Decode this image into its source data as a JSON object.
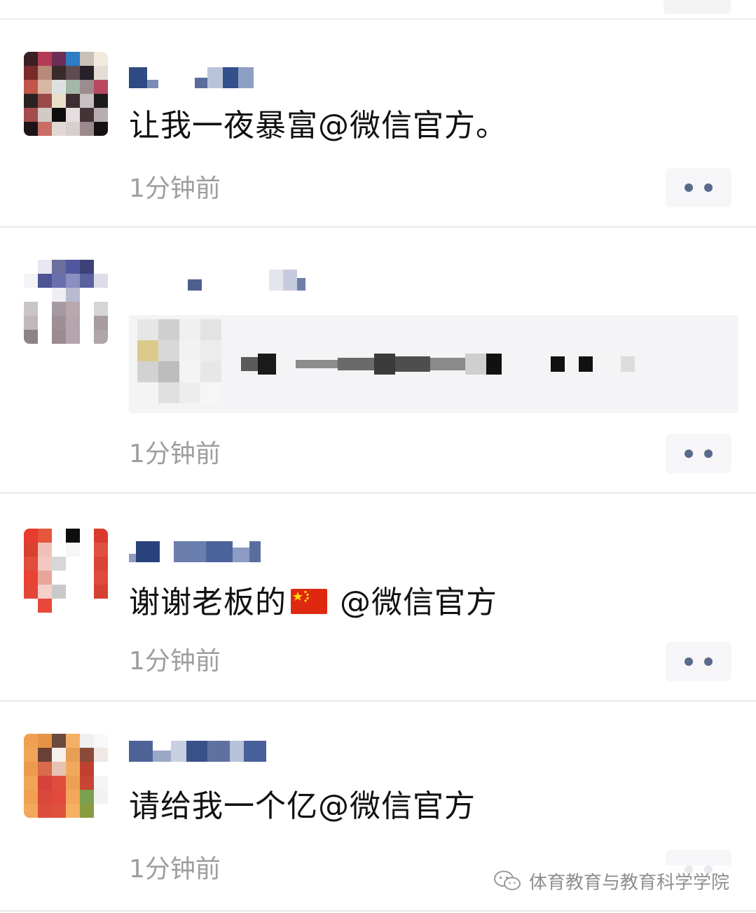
{
  "posts": [
    {
      "content": "让我一夜暴富@微信官方。",
      "time": "1分钟前"
    },
    {
      "content": "",
      "time": "1分钟前"
    },
    {
      "content_before": "谢谢老板的",
      "flag_icon": "china-flag-icon",
      "content_after": "@微信官方",
      "time": "1分钟前"
    },
    {
      "content": "请给我一个亿@微信官方",
      "time": "1分钟前"
    }
  ],
  "watermark": {
    "icon": "wechat-official-account-icon",
    "text": "体育教育与教育科学学院"
  },
  "colors": {
    "text": "#111111",
    "time": "#9e9e9e",
    "more_dots": "#5a6a8a",
    "more_bg": "#f6f6f8",
    "divider": "#e9e9e9"
  }
}
